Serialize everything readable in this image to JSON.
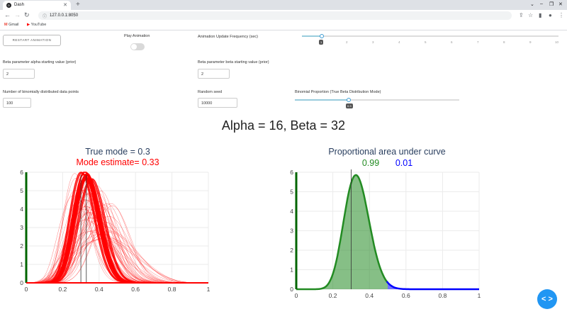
{
  "browser": {
    "tab_title": "Dash",
    "tab_favicon_letter": "D",
    "url": "127.0.0.1:8050",
    "bookmarks": [
      {
        "label": "Gmail",
        "icon": "gmail-icon"
      },
      {
        "label": "YouTube",
        "icon": "youtube-icon"
      }
    ]
  },
  "controls": {
    "restart_label": "RESTART ANIMATION",
    "play_label": "Play Animation",
    "freq_label": "Animation Update Frequency (sec)",
    "freq_value": 1,
    "freq_ticks": [
      "2",
      "3",
      "4",
      "5",
      "6",
      "7",
      "8",
      "9",
      "10"
    ],
    "alpha_label": "Beta parameter alpha starting value (prior)",
    "alpha_value": "2",
    "beta_label": "Beta parameter beta starting value (prior)",
    "beta_value": "2",
    "n_label": "Number of binomially distributed data points",
    "n_value": "100",
    "seed_label": "Random seed",
    "seed_value": "10000",
    "prop_label": "Binomial Proportion (True Beta Distribution Mode)",
    "prop_value": "0.3"
  },
  "headline": "Alpha = 16, Beta = 32",
  "left_chart": {
    "title": "True mode = 0.3",
    "subtitle": "Mode estimate= 0.33",
    "title_color": "#2a3f5f",
    "subtitle_color": "#ff0000"
  },
  "right_chart": {
    "title": "Proportional area under curve",
    "left_area": "0.99",
    "right_area": "0.01",
    "left_color": "#228b22",
    "right_color": "#0000ff"
  },
  "chart_data": [
    {
      "type": "line",
      "title": "True mode = 0.3",
      "subtitle": "Mode estimate= 0.33",
      "xlim": [
        0,
        1
      ],
      "ylim": [
        0,
        6
      ],
      "x_ticks": [
        "0",
        "0.2",
        "0.4",
        "0.6",
        "0.8",
        "1"
      ],
      "y_ticks": [
        "0",
        "1",
        "2",
        "3",
        "4",
        "5",
        "6"
      ],
      "vertical_lines": [
        0.3,
        0.33
      ],
      "final_distribution": {
        "alpha": 16,
        "beta": 32
      },
      "grid": true
    },
    {
      "type": "area",
      "title": "Proportional area under curve",
      "xlim": [
        0,
        1
      ],
      "ylim": [
        0,
        6
      ],
      "x_ticks": [
        "0",
        "0.2",
        "0.4",
        "0.6",
        "0.8",
        "1"
      ],
      "y_ticks": [
        "0",
        "1",
        "2",
        "3",
        "4",
        "5",
        "6"
      ],
      "vertical_line": 0.3,
      "distribution": {
        "alpha": 16,
        "beta": 32
      },
      "split_at": 0.5,
      "areas": {
        "left": 0.99,
        "right": 0.01
      },
      "grid": true
    }
  ],
  "fab_label": "< >"
}
